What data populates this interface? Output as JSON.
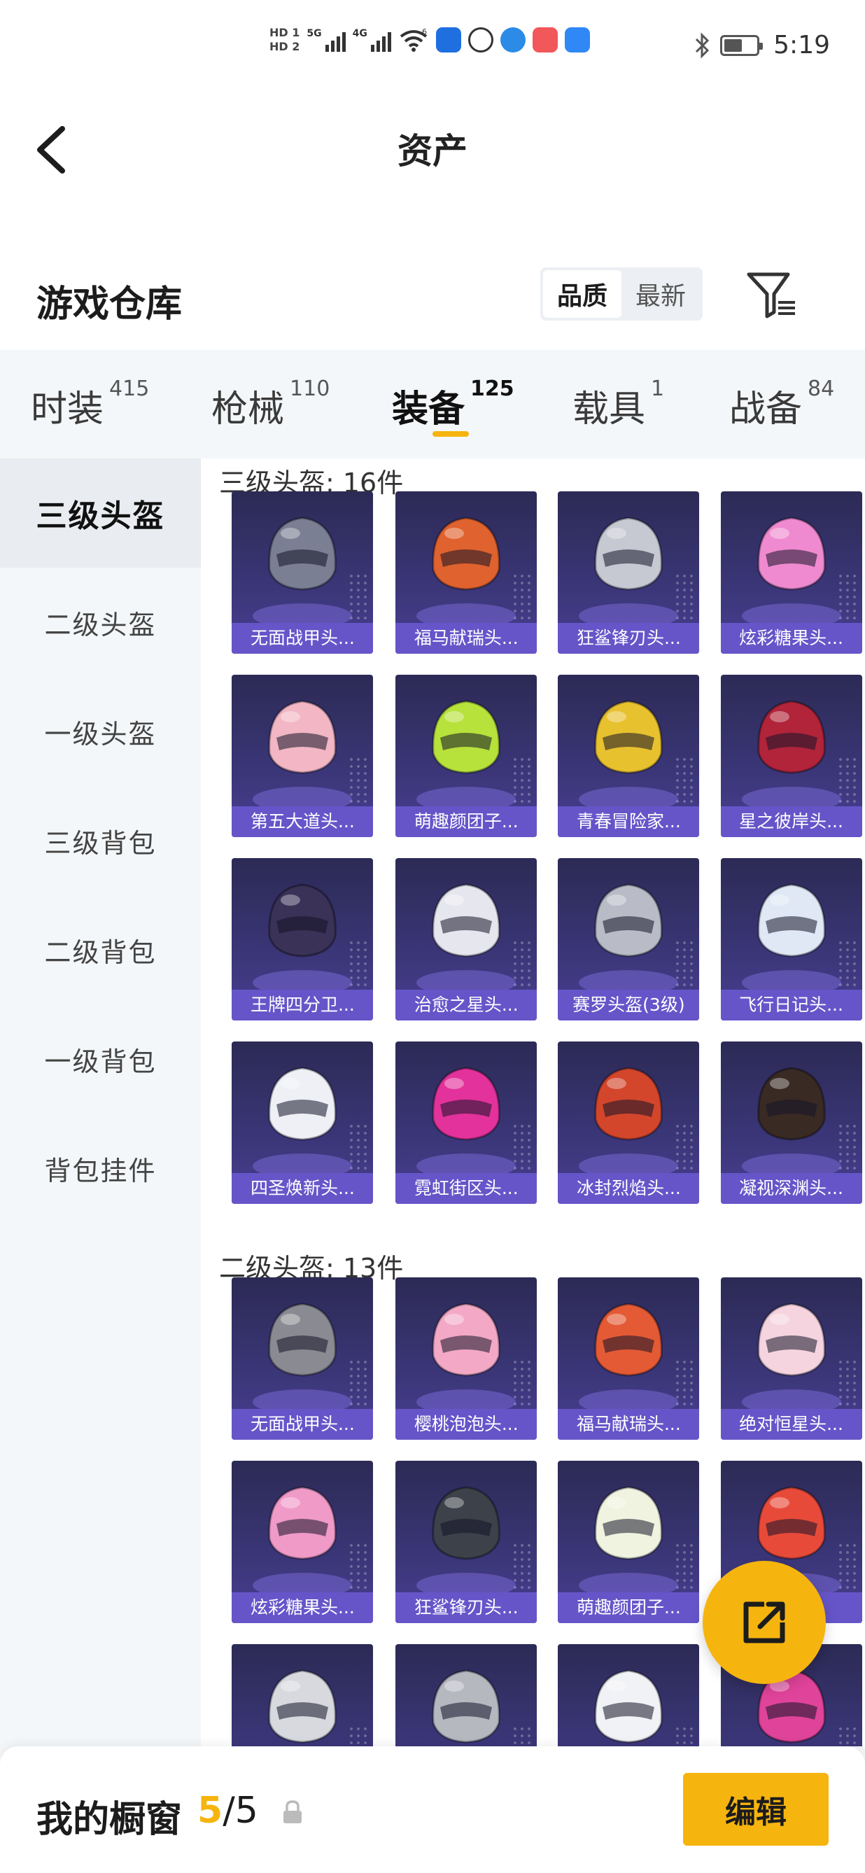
{
  "status_bar": {
    "hd1": "HD 1",
    "hd2": "HD 2",
    "net1": "5G",
    "net2": "4G",
    "wifi": "6",
    "time": "5:19",
    "icons": [
      "bulb-icon",
      "wechat-icon",
      "browser-icon",
      "shop-icon",
      "cloud-icon"
    ],
    "icon_colors": [
      "#1f6fe0",
      "#333333",
      "#2b8be6",
      "#f2575a",
      "#2f88f5"
    ]
  },
  "nav": {
    "title": "资产"
  },
  "warehouse": {
    "title": "游戏仓库",
    "sort": {
      "quality": "品质",
      "newest": "最新",
      "selected": "品质"
    }
  },
  "tabs": [
    {
      "label": "时装",
      "count": "415"
    },
    {
      "label": "枪械",
      "count": "110"
    },
    {
      "label": "装备",
      "count": "125",
      "active": true
    },
    {
      "label": "载具",
      "count": "1"
    },
    {
      "label": "战备",
      "count": "84"
    }
  ],
  "sidebar": [
    {
      "label": "三级头盔",
      "active": true
    },
    {
      "label": "二级头盔"
    },
    {
      "label": "一级头盔"
    },
    {
      "label": "三级背包"
    },
    {
      "label": "二级背包"
    },
    {
      "label": "一级背包"
    },
    {
      "label": "背包挂件"
    }
  ],
  "sections": [
    {
      "title": "三级头盔: 16件",
      "items": [
        {
          "name": "无面战甲头...",
          "color": "#7a7f93"
        },
        {
          "name": "福马献瑞头...",
          "color": "#e0622e"
        },
        {
          "name": "狂鲨锋刃头...",
          "color": "#c6c8d2"
        },
        {
          "name": "炫彩糖果头...",
          "color": "#f08ad0"
        },
        {
          "name": "第五大道头...",
          "color": "#f2b6c4"
        },
        {
          "name": "萌趣颜团子...",
          "color": "#b7e23b"
        },
        {
          "name": "青春冒险家...",
          "color": "#e8c12e"
        },
        {
          "name": "星之彼岸头...",
          "color": "#b1243a"
        },
        {
          "name": "王牌四分卫...",
          "color": "#3a3257"
        },
        {
          "name": "治愈之星头...",
          "color": "#e6e7ee"
        },
        {
          "name": "赛罗头盔(3级)",
          "color": "#b9bcc6"
        },
        {
          "name": "飞行日记头...",
          "color": "#dfe8f4"
        },
        {
          "name": "四圣焕新头...",
          "color": "#eef0f6"
        },
        {
          "name": "霓虹街区头...",
          "color": "#e3329b"
        },
        {
          "name": "冰封烈焰头...",
          "color": "#d3462c"
        },
        {
          "name": "凝视深渊头...",
          "color": "#3a2a24"
        }
      ]
    },
    {
      "title": "二级头盔: 13件",
      "items": [
        {
          "name": "无面战甲头...",
          "color": "#8a8b92"
        },
        {
          "name": "樱桃泡泡头...",
          "color": "#f3a9c6"
        },
        {
          "name": "福马献瑞头...",
          "color": "#e45a35"
        },
        {
          "name": "绝对恒星头...",
          "color": "#f5d4e0"
        },
        {
          "name": "炫彩糖果头...",
          "color": "#f09ac8"
        },
        {
          "name": "狂鲨锋刃头...",
          "color": "#3d4149"
        },
        {
          "name": "萌趣颜团子...",
          "color": "#f0f3e0"
        },
        {
          "name": "",
          "color": "#e84a3a"
        },
        {
          "name": "",
          "color": "#d8d9de"
        },
        {
          "name": "",
          "color": "#b6b8c0"
        },
        {
          "name": "",
          "color": "#f1f2f5"
        },
        {
          "name": "",
          "color": "#e0439a"
        }
      ]
    }
  ],
  "bottom": {
    "title": "我的橱窗",
    "current": "5",
    "separator": "/",
    "total": "5",
    "edit_label": "编辑"
  },
  "colors": {
    "accent": "#f6b40e",
    "card_label": "#6655c9",
    "card_bg": "#3b3678"
  }
}
